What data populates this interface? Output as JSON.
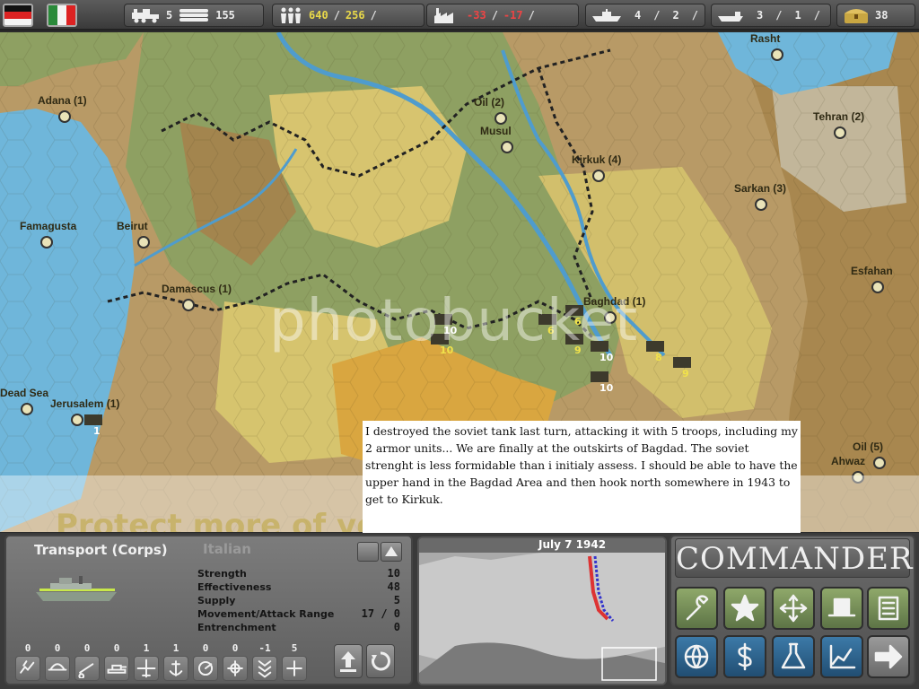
{
  "topbar": {
    "flags": [
      "germany-flag",
      "italy-flag"
    ],
    "production": {
      "icon": "locomotive-icon",
      "value": "5"
    },
    "oil": {
      "icon": "oil-barrels-icon",
      "value": "155"
    },
    "manpower": {
      "icon": "soldiers-icon",
      "value": "640",
      "sep": "/",
      "max": "256",
      "tail": "/"
    },
    "industry": {
      "icon": "factory-icon",
      "value": "-33",
      "sep": "/",
      "max": "-17",
      "tail": "/"
    },
    "navy": {
      "icon": "warship-icon",
      "value": "4",
      "sep": "/",
      "max": "2",
      "tail": "/"
    },
    "transport": {
      "icon": "transport-ship-icon",
      "value": "3",
      "sep": "/",
      "max": "1",
      "tail": "/"
    },
    "treasury": {
      "icon": "treasure-chest-icon",
      "value": "38"
    }
  },
  "map": {
    "cities": [
      {
        "name": "Adana (1)"
      },
      {
        "name": "Oil (2)"
      },
      {
        "name": "Musul"
      },
      {
        "name": "Rasht"
      },
      {
        "name": "Tehran (2)"
      },
      {
        "name": "Kirkuk (4)"
      },
      {
        "name": "Sarkan (3)"
      },
      {
        "name": "Famagusta"
      },
      {
        "name": "Beirut"
      },
      {
        "name": "Damascus (1)"
      },
      {
        "name": "Esfahan"
      },
      {
        "name": "Baghdad (1)"
      },
      {
        "name": "Jerusalem (1)"
      },
      {
        "name": "Dead Sea"
      },
      {
        "name": "Oil (5)"
      },
      {
        "name": "Ahwaz"
      }
    ],
    "unit_strengths": [
      "10",
      "6",
      "6",
      "10",
      "9",
      "8",
      "10",
      "9",
      "10",
      "1"
    ]
  },
  "watermark": {
    "photobucket": "photobucket",
    "protect": "Protect more of your memories for less!"
  },
  "comment": {
    "text": "I destroyed the soviet tank last turn, attacking it with 5 troops, including my 2 armor units... We are finally at the outskirts of Bagdad. The soviet strenght is less formidable than i initialy assess. I should be able to have the upper hand in the Bagdad Area and then hook north somewhere in 1943 to get to Kirkuk."
  },
  "unit_panel": {
    "title": "Transport (Corps)",
    "nation": "Italian",
    "stats": [
      {
        "label": "Strength",
        "value": "10"
      },
      {
        "label": "Effectiveness",
        "value": "48"
      },
      {
        "label": "Supply",
        "value": "5"
      },
      {
        "label": "Movement/Attack Range",
        "value": "17 / 0"
      },
      {
        "label": "Entrenchment",
        "value": "0"
      }
    ],
    "strength_vs": [
      {
        "icon": "infantry-icon",
        "value": "0"
      },
      {
        "icon": "helmet-icon",
        "value": "0"
      },
      {
        "icon": "artillery-icon",
        "value": "0"
      },
      {
        "icon": "tank-icon",
        "value": "0"
      },
      {
        "icon": "aircraft-icon",
        "value": "1"
      },
      {
        "icon": "anchor-icon",
        "value": "1"
      },
      {
        "icon": "radar-icon",
        "value": "0"
      },
      {
        "icon": "crosshair-icon",
        "value": "0"
      },
      {
        "icon": "rank-chevrons-icon",
        "value": "-1"
      },
      {
        "icon": "plus-icon",
        "value": "5"
      }
    ]
  },
  "minimap": {
    "date": "July 7 1942"
  },
  "commander": {
    "logo": "COMMANDER",
    "buttons": [
      {
        "icon": "wrench-icon",
        "color": "green"
      },
      {
        "icon": "star-icon",
        "color": "green"
      },
      {
        "icon": "move-arrows-icon",
        "color": "green"
      },
      {
        "icon": "top-hat-icon",
        "color": "green"
      },
      {
        "icon": "report-list-icon",
        "color": "green"
      },
      {
        "icon": "globe-icon",
        "color": "blue"
      },
      {
        "icon": "dollar-icon",
        "color": "blue"
      },
      {
        "icon": "flask-icon",
        "color": "blue"
      },
      {
        "icon": "graph-icon",
        "color": "blue"
      },
      {
        "icon": "end-turn-arrow-icon",
        "color": "gray"
      }
    ]
  },
  "colors": {
    "sea": "#6fb6da",
    "plains": "#8a9d5c",
    "hills": "#a98d55",
    "desert": "#d9c46a",
    "mountains": "#b89a66",
    "river": "#4f9ccd",
    "highlight": "#b9a544"
  }
}
